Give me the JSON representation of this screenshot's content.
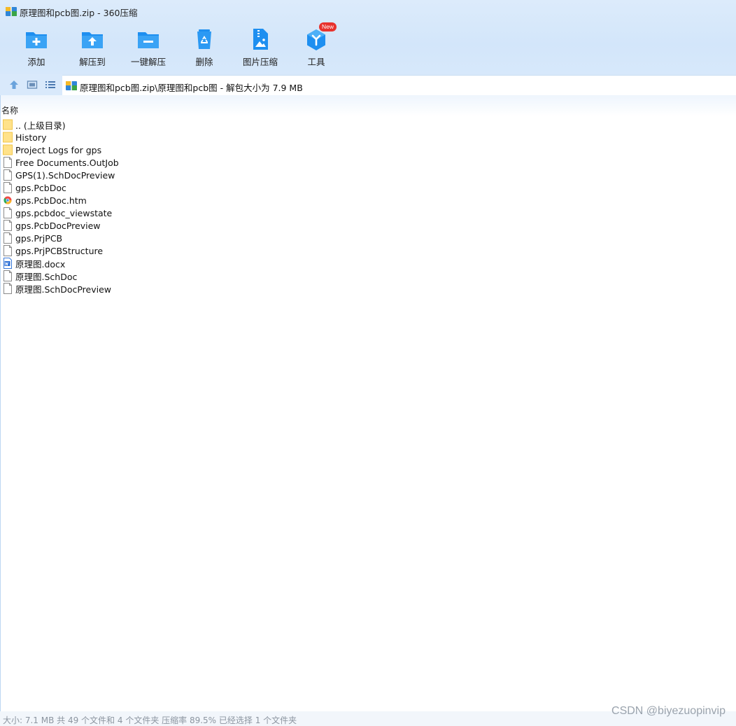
{
  "window": {
    "title": "原理图和pcb图.zip - 360压缩"
  },
  "toolbar": {
    "add_label": "添加",
    "extract_to_label": "解压到",
    "one_click_extract_label": "一键解压",
    "delete_label": "删除",
    "image_compress_label": "图片压缩",
    "tools_label": "工具",
    "tools_badge": "New",
    "accent_color": "#1e8ff0"
  },
  "address": {
    "path_text": "原理图和pcb图.zip\\原理图和pcb图 - 解包大小为 7.9 MB"
  },
  "list": {
    "column_name": "名称",
    "files": [
      {
        "name": ".. (上级目录)",
        "icon": "folder-icon"
      },
      {
        "name": "History",
        "icon": "folder-icon"
      },
      {
        "name": "Project Logs for gps",
        "icon": "folder-icon"
      },
      {
        "name": "Free Documents.OutJob",
        "icon": "file-icon"
      },
      {
        "name": "GPS(1).SchDocPreview",
        "icon": "file-icon"
      },
      {
        "name": "gps.PcbDoc",
        "icon": "file-icon"
      },
      {
        "name": "gps.PcbDoc.htm",
        "icon": "browser-icon"
      },
      {
        "name": "gps.pcbdoc_viewstate",
        "icon": "file-icon"
      },
      {
        "name": "gps.PcbDocPreview",
        "icon": "file-icon"
      },
      {
        "name": "gps.PrjPCB",
        "icon": "file-icon"
      },
      {
        "name": "gps.PrjPCBStructure",
        "icon": "file-icon"
      },
      {
        "name": "原理图.docx",
        "icon": "word-doc-icon"
      },
      {
        "name": "原理图.SchDoc",
        "icon": "file-icon"
      },
      {
        "name": "原理图.SchDocPreview",
        "icon": "file-icon"
      }
    ]
  },
  "status": {
    "text": "大小: 7.1 MB 共 49 个文件和 4 个文件夹 压缩率 89.5% 已经选择 1 个文件夹"
  },
  "watermark": {
    "text": "CSDN @biyezuopinvip"
  }
}
